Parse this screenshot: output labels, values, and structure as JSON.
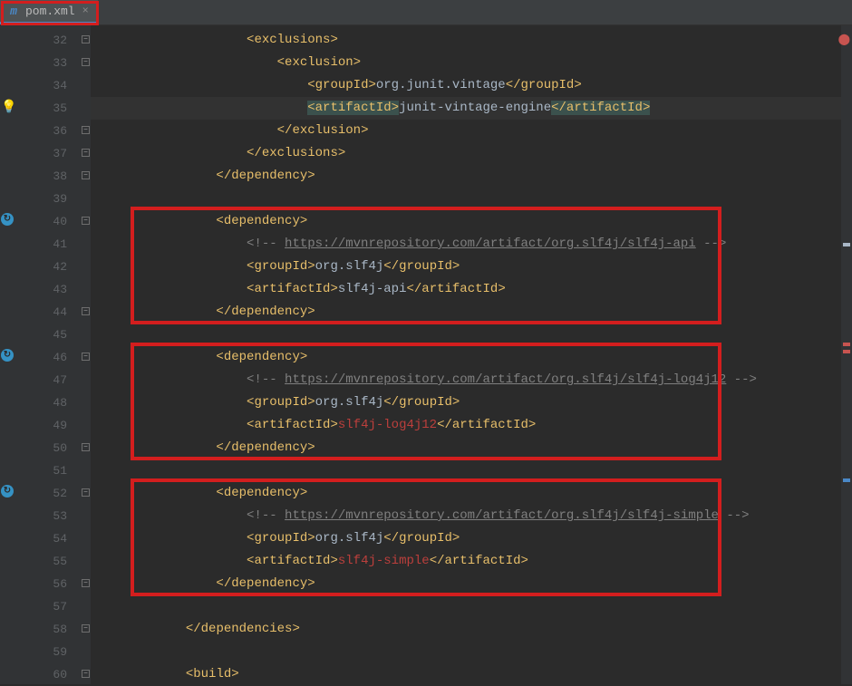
{
  "tab": {
    "icon_letter": "m",
    "label": "pom.xml"
  },
  "line_numbers": [
    32,
    33,
    34,
    35,
    36,
    37,
    38,
    39,
    40,
    41,
    42,
    43,
    44,
    45,
    46,
    47,
    48,
    49,
    50,
    51,
    52,
    53,
    54,
    55,
    56,
    57,
    58,
    59,
    60
  ],
  "xml": {
    "exclusions_open": "exclusions",
    "exclusion_open": "exclusion",
    "groupId": "groupId",
    "artifactId": "artifactId",
    "junit_group": "org.junit.vintage",
    "junit_artifact": "junit-vintage-engine",
    "exclusion_close": "exclusion",
    "exclusions_close": "exclusions",
    "dependency_open": "dependency",
    "dependency_close": "dependency",
    "slf4j_group": "org.slf4j",
    "api_artifact": "slf4j-api",
    "log4j_artifact": "slf4j-log4j12",
    "simple_artifact": "slf4j-simple",
    "url_api": "https://mvnrepository.com/artifact/org.slf4j/slf4j-api",
    "url_log4j": "https://mvnrepository.com/artifact/org.slf4j/slf4j-log4j12",
    "url_simple": "https://mvnrepository.com/artifact/org.slf4j/slf4j-simple",
    "dependencies_close": "dependencies",
    "build_open": "build"
  },
  "indent": {
    "i3": "            ",
    "i4": "                ",
    "i5": "                    ",
    "i6": "                        ",
    "i7": "                            "
  },
  "cmt_open": "<!-- ",
  "cmt_close": " -->",
  "lt": "<",
  "gt": ">",
  "lts": "</"
}
